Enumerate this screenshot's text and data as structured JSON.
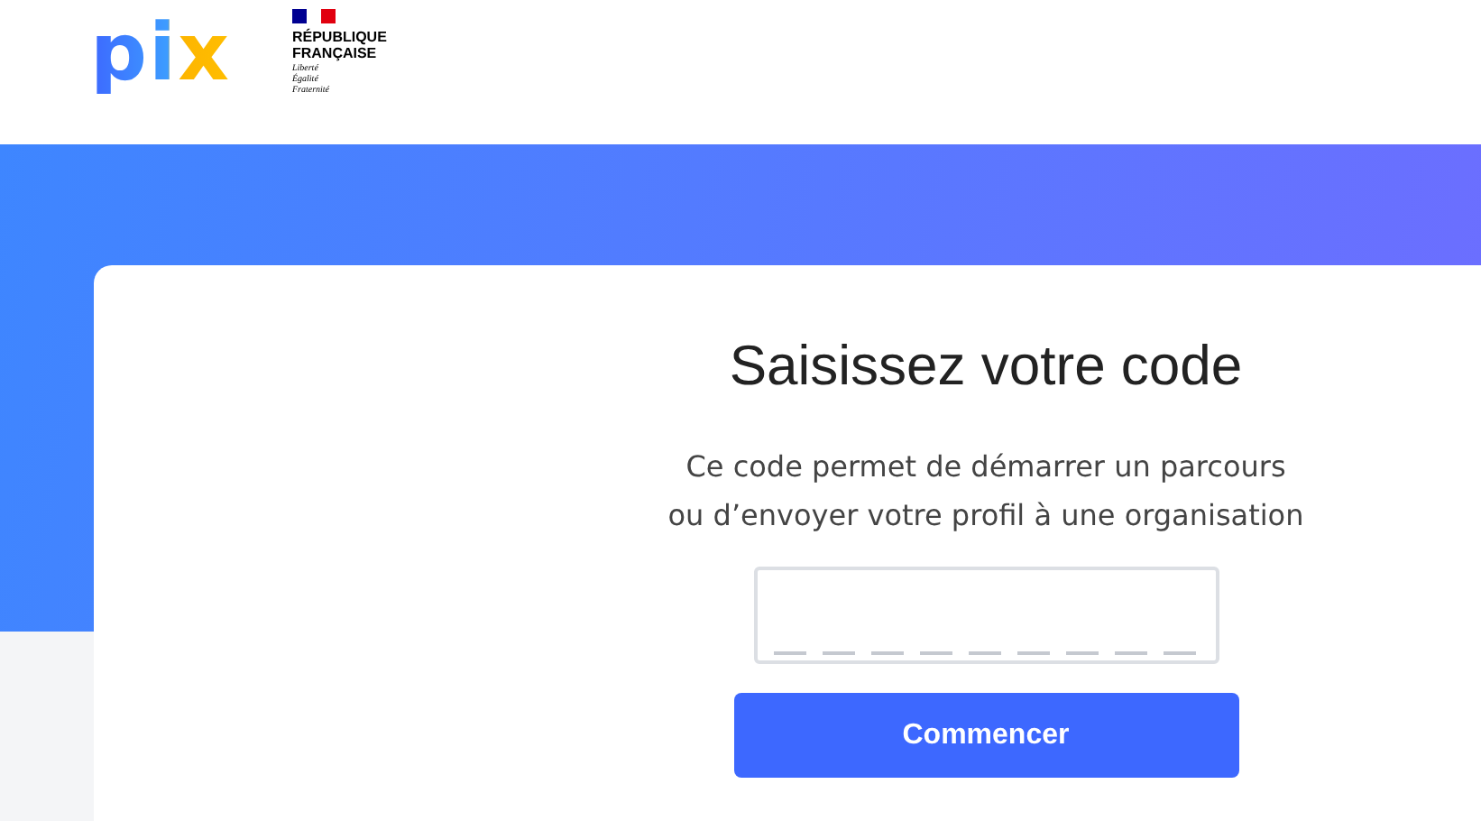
{
  "header": {
    "logo": "pix",
    "republic": {
      "name": [
        "RÉPUBLIQUE",
        "FRANÇAISE"
      ],
      "motto": [
        "Liberté",
        "Égalité",
        "Fraternité"
      ]
    }
  },
  "card": {
    "title": "Saisissez votre code",
    "description": [
      "Ce code permet de démarrer un parcours",
      "ou d’envoyer votre profil à une organisation"
    ],
    "button": "Commencer"
  }
}
